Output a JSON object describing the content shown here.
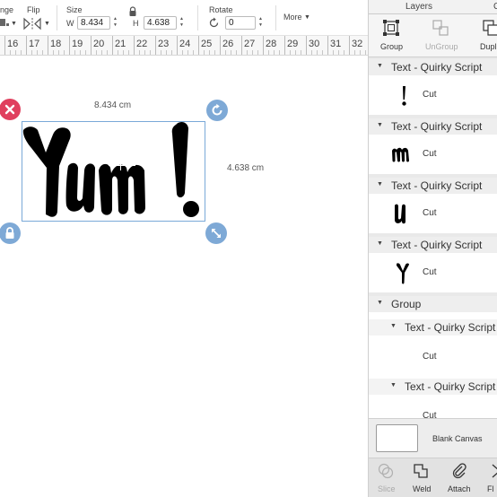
{
  "toolbar": {
    "arrange_label": "nge",
    "flip_label": "Flip",
    "size_label": "Size",
    "width_prefix": "W",
    "width_value": "8.434",
    "height_prefix": "H",
    "height_value": "4.638",
    "rotate_label": "Rotate",
    "rotate_value": "0",
    "more_label": "More"
  },
  "ruler": {
    "numbers": [
      "16",
      "17",
      "18",
      "19",
      "20",
      "21",
      "22",
      "23",
      "24",
      "25",
      "26",
      "27",
      "28",
      "29",
      "30",
      "31",
      "32"
    ]
  },
  "canvas": {
    "width_readout": "8.434 cm",
    "height_readout": "4.638 cm",
    "selection_colors": {
      "delete_handle": "#e0405e",
      "other_handles": "#7ea9d6",
      "selection_border": "#7aa9d8"
    }
  },
  "panel": {
    "tabs": [
      "Layers",
      "C"
    ],
    "actions": [
      {
        "label": "Group",
        "icon": "group-icon",
        "enabled": true
      },
      {
        "label": "UnGroup",
        "icon": "ungroup-icon",
        "enabled": false
      },
      {
        "label": "Dupli",
        "icon": "duplicate-icon",
        "enabled": true
      }
    ],
    "layers": [
      {
        "title": "Text - Quirky Script",
        "op": "Cut",
        "glyph": "!"
      },
      {
        "title": "Text - Quirky Script",
        "op": "Cut",
        "glyph": "m"
      },
      {
        "title": "Text - Quirky Script",
        "op": "Cut",
        "glyph": "u"
      },
      {
        "title": "Text - Quirky Script",
        "op": "Cut",
        "glyph": "Y"
      }
    ],
    "group": {
      "title": "Group",
      "children": [
        {
          "title": "Text - Quirky Script",
          "op": "Cut"
        },
        {
          "title": "Text - Quirky Script",
          "op": "Cut"
        }
      ]
    },
    "blank_canvas_label": "Blank Canvas",
    "bottom_actions": [
      {
        "label": "Slice",
        "icon": "slice-icon",
        "enabled": false
      },
      {
        "label": "Weld",
        "icon": "weld-icon",
        "enabled": true
      },
      {
        "label": "Attach",
        "icon": "attach-icon",
        "enabled": true
      },
      {
        "label": "Fl",
        "icon": "flatten-icon",
        "enabled": true
      }
    ]
  }
}
